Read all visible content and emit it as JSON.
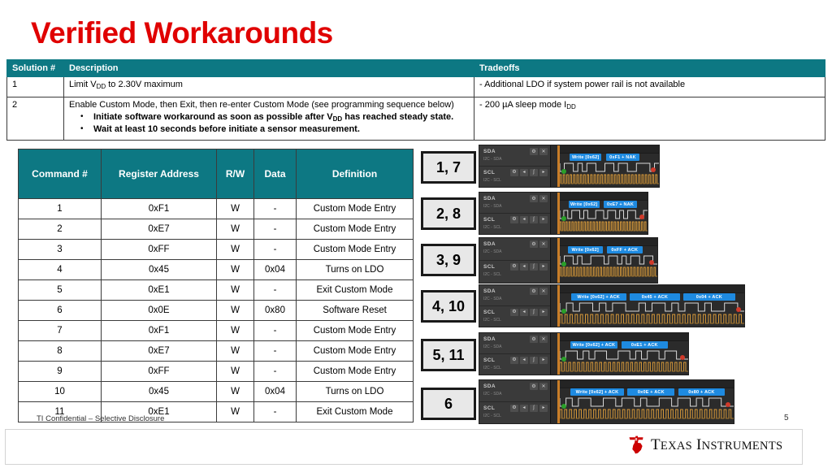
{
  "slide": {
    "title": "Verified Workarounds",
    "page_number": "5",
    "footer_note": "TI Confidential – Selective Disclosure",
    "brand": "TEXAS INSTRUMENTS",
    "accent_teal": "#0d7883",
    "title_red": "#e00000"
  },
  "solutions_table": {
    "headers": [
      "Solution #",
      "Description",
      "Tradeoffs"
    ],
    "rows": [
      {
        "solution": "1",
        "description_html": "Limit V<sub>DD</sub> to 2.30V maximum",
        "bullets": [],
        "tradeoff_html": "- Additional LDO if system power rail is not available"
      },
      {
        "solution": "2",
        "description_html": "Enable Custom Mode, then Exit, then re-enter Custom Mode (see programming sequence below)",
        "bullets": [
          "Initiate software workaround as soon as possible after V<sub>DD</sub> has reached steady state.",
          "Wait at least 10 seconds before initiate a sensor measurement."
        ],
        "tradeoff_html": "- 200 µA sleep mode I<sub>DD</sub>"
      }
    ]
  },
  "command_table": {
    "headers": [
      "Command #",
      "Register Address",
      "R/W",
      "Data",
      "Definition"
    ],
    "rows": [
      [
        "1",
        "0xF1",
        "W",
        "-",
        "Custom Mode Entry"
      ],
      [
        "2",
        "0xE7",
        "W",
        "-",
        "Custom Mode Entry"
      ],
      [
        "3",
        "0xFF",
        "W",
        "-",
        "Custom Mode Entry"
      ],
      [
        "4",
        "0x45",
        "W",
        "0x04",
        "Turns on LDO"
      ],
      [
        "5",
        "0xE1",
        "W",
        "-",
        "Exit Custom Mode"
      ],
      [
        "6",
        "0x0E",
        "W",
        "0x80",
        "Software Reset"
      ],
      [
        "7",
        "0xF1",
        "W",
        "-",
        "Custom Mode Entry"
      ],
      [
        "8",
        "0xE7",
        "W",
        "-",
        "Custom Mode Entry"
      ],
      [
        "9",
        "0xFF",
        "W",
        "-",
        "Custom Mode Entry"
      ],
      [
        "10",
        "0x45",
        "W",
        "0x04",
        "Turns on LDO"
      ],
      [
        "11",
        "0xE1",
        "W",
        "-",
        "Exit Custom Mode"
      ]
    ]
  },
  "callouts": [
    {
      "label": "1, 7"
    },
    {
      "label": "2, 8"
    },
    {
      "label": "3, 9"
    },
    {
      "label": "4, 10"
    },
    {
      "label": "5, 11"
    },
    {
      "label": "6"
    }
  ],
  "scopes": [
    {
      "channels": [
        {
          "name": "SDA",
          "sub": "I2C - SDA"
        },
        {
          "name": "SCL",
          "sub": "I2C - SCL"
        }
      ],
      "annotations": [
        "Write [0x62]",
        "0xF1 + NAK"
      ]
    },
    {
      "channels": [
        {
          "name": "SDA",
          "sub": "I2C - SDA"
        },
        {
          "name": "SCL",
          "sub": "I2C - SCL"
        }
      ],
      "annotations": [
        "Write [0x62]",
        "0xE7 + NAK"
      ]
    },
    {
      "channels": [
        {
          "name": "SDA",
          "sub": "I2C - SDA"
        },
        {
          "name": "SCL",
          "sub": "I2C - SCL"
        }
      ],
      "annotations": [
        "Write [0x62]",
        "0xFF + ACK"
      ]
    },
    {
      "channels": [
        {
          "name": "SDA",
          "sub": "I2C - SDA"
        },
        {
          "name": "SCL",
          "sub": "I2C - SCL"
        }
      ],
      "annotations": [
        "Write [0x62] + ACK",
        "0x45 + ACK",
        "0x04 + ACK"
      ]
    },
    {
      "channels": [
        {
          "name": "SDA",
          "sub": "I2C - SDA"
        },
        {
          "name": "SCL",
          "sub": "I2C - SCL"
        }
      ],
      "annotations": [
        "Write [0x62] + ACK",
        "0xE1 + ACK"
      ]
    },
    {
      "channels": [
        {
          "name": "SDA",
          "sub": "I2C - SDA"
        },
        {
          "name": "SCL",
          "sub": "I2C - SCL"
        }
      ],
      "annotations": [
        "Write [0x62] + ACK",
        "0x0E + ACK",
        "0x80 + ACK"
      ]
    }
  ],
  "scope_controls": {
    "gear": "⚙",
    "close": "✕",
    "prev": "◂",
    "edge": "∫",
    "next": "▸"
  }
}
